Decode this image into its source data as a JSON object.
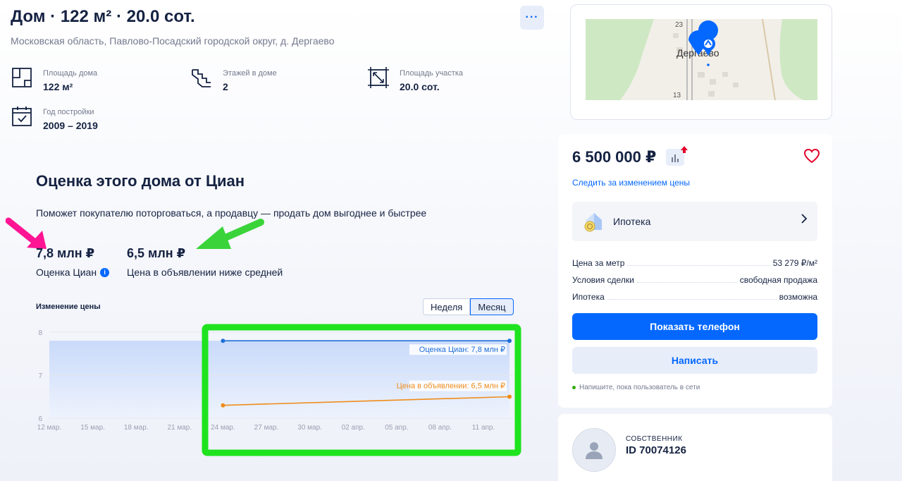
{
  "header": {
    "title": "Дом · 122 м² · 20.0 сот.",
    "address": "Московская область, Павлово-Посадский городской округ, д. Дергаево",
    "more_label": "···"
  },
  "features": [
    {
      "icon": "house-area-icon",
      "label": "Площадь дома",
      "value": "122 м²"
    },
    {
      "icon": "stairs-icon",
      "label": "Этажей в доме",
      "value": "2"
    },
    {
      "icon": "land-area-icon",
      "label": "Площадь участка",
      "value": "20.0 сот."
    },
    {
      "icon": "calendar-icon",
      "label": "Год постройки",
      "value": "2009 – 2019"
    }
  ],
  "evaluation": {
    "title": "Оценка этого дома от Циан",
    "subtitle": "Поможет покупателю поторговаться, а продавцу — продать дом выгоднее и быстрее",
    "cian_value": "7,8 млн ₽",
    "cian_caption": "Оценка Циан",
    "listing_value": "6,5 млн ₽",
    "listing_caption": "Цена в объявлении ниже средней",
    "info_glyph": "i"
  },
  "chart_header": {
    "title": "Изменение цены",
    "toggle": [
      "Неделя",
      "Месяц"
    ],
    "active_toggle": "Месяц"
  },
  "chart_data": {
    "type": "line",
    "x": [
      "12 мар.",
      "15 мар.",
      "18 мар.",
      "21 мар.",
      "24 мар.",
      "27 мар.",
      "30 мар.",
      "02 апр.",
      "05 апр.",
      "08 апр.",
      "11 апр."
    ],
    "ylim": [
      6,
      8
    ],
    "yticks": [
      "6",
      "7",
      "8"
    ],
    "series": [
      {
        "name": "Оценка Циан",
        "label": "Оценка Циан: 7,8 млн ₽",
        "color": "#1f6fd6",
        "points": [
          [
            4,
            7.8
          ],
          [
            10.6,
            7.8
          ]
        ],
        "area_from": 0
      },
      {
        "name": "Цена в объявлении",
        "label": "Цена в объявлении: 6,5 млн ₽",
        "color": "#f08c1a",
        "points": [
          [
            4,
            6.3
          ],
          [
            10.6,
            6.5
          ]
        ]
      }
    ],
    "area_fill": "#dbe7fb",
    "grid": true
  },
  "annotations": {
    "highlight_color": "#1ee31e",
    "arrow_green": "#3ad43a",
    "arrow_pink": "#ff1493"
  },
  "map": {
    "village_label": "Дергаево",
    "house_numbers": [
      "23",
      "13"
    ],
    "pin_color": "#0468ff"
  },
  "sidebar": {
    "price": "6 500 000 ₽",
    "follow_label": "Следить за изменением цены",
    "mortgage_label": "Ипотека",
    "rows": [
      {
        "k": "Цена за метр",
        "v": "53 279 ₽/м²"
      },
      {
        "k": "Условия сделки",
        "v": "свободная продажа"
      },
      {
        "k": "Ипотека",
        "v": "возможна"
      }
    ],
    "phone_button": "Показать телефон",
    "write_button": "Написать",
    "online_text": "Напишите, пока пользователь в сети"
  },
  "owner": {
    "role": "СОБСТВЕННИК",
    "id": "ID 70074126"
  }
}
